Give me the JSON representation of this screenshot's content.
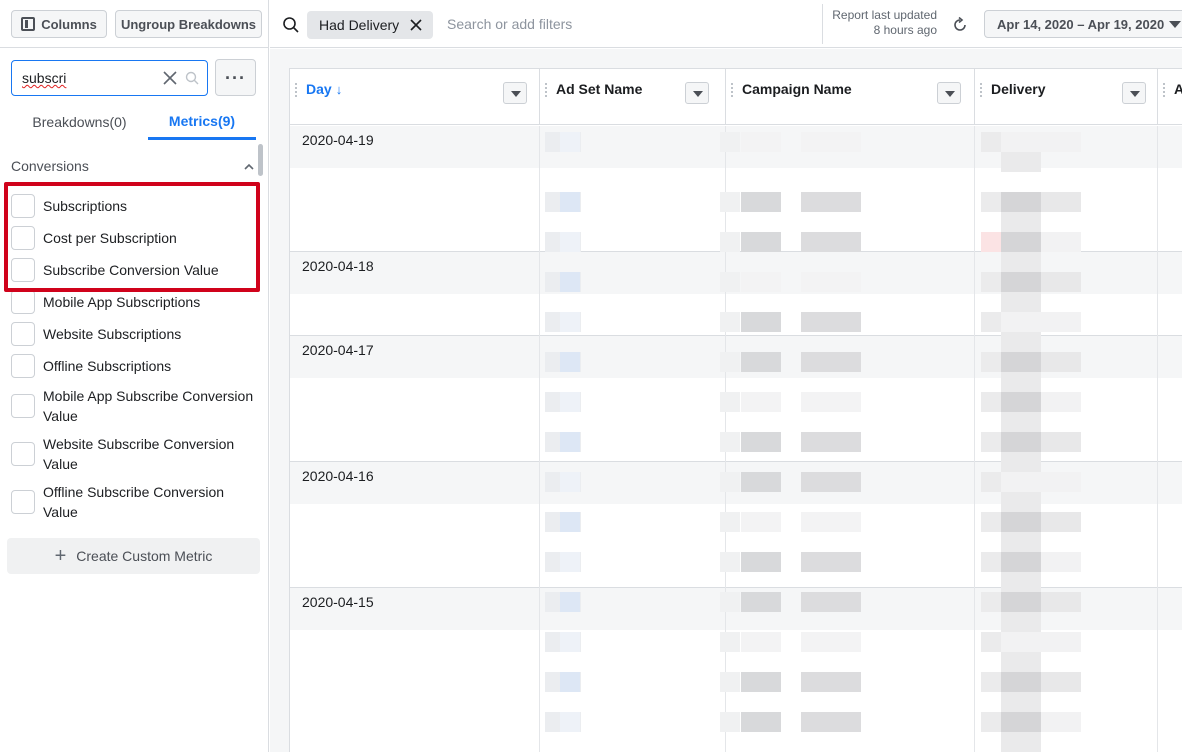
{
  "toolbar": {
    "columns_label": "Columns",
    "ungroup_label": "Ungroup Breakdowns"
  },
  "panel": {
    "search_value": "subscri",
    "tabs": [
      {
        "label": "Breakdowns(0)"
      },
      {
        "label": "Metrics(9)"
      }
    ],
    "section_title": "Conversions",
    "metrics": [
      {
        "label": "Subscriptions"
      },
      {
        "label": "Cost per Subscription"
      },
      {
        "label": "Subscribe Conversion Value"
      },
      {
        "label": "Mobile App Subscriptions"
      },
      {
        "label": "Website Subscriptions"
      },
      {
        "label": "Offline Subscriptions"
      },
      {
        "label": "Mobile App Subscribe Conversion Value"
      },
      {
        "label": "Website Subscribe Conversion Value"
      },
      {
        "label": "Offline Subscribe Conversion Value"
      }
    ],
    "highlighted_count": 3,
    "custom_metric_label": "Create Custom Metric"
  },
  "filters": {
    "chip_label": "Had Delivery",
    "placeholder": "Search or add filters",
    "report_updated_line1": "Report last updated",
    "report_updated_line2": "8 hours ago",
    "date_range": "Apr 14, 2020 – Apr 19, 2020"
  },
  "table": {
    "columns": [
      {
        "label": "Day",
        "sort": "↓"
      },
      {
        "label": "Ad Set Name"
      },
      {
        "label": "Campaign Name"
      },
      {
        "label": "Delivery"
      },
      {
        "label": "A"
      }
    ],
    "days": [
      "2020-04-19",
      "2020-04-18",
      "2020-04-17",
      "2020-04-16",
      "2020-04-15"
    ]
  },
  "colors": {
    "accent": "#1877f2",
    "highlight": "#d0021b"
  },
  "icons": [
    "columns-icon",
    "clear-icon",
    "search-icon",
    "more-icon",
    "chevron-up-icon",
    "close-icon",
    "refresh-icon",
    "caret-down-icon",
    "plus-icon",
    "sort-down-icon"
  ]
}
